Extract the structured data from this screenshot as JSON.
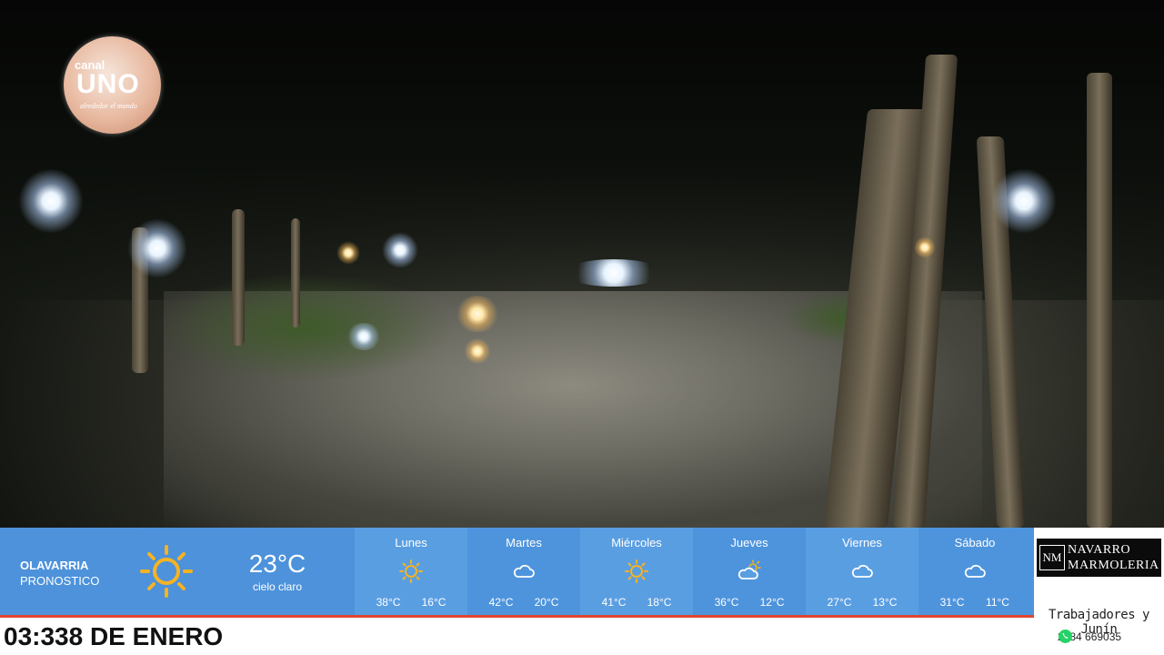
{
  "stream": {
    "channel_logo": {
      "line1": "canal",
      "line2": "UNO",
      "tagline": "alrededor el mundo",
      "icon": "channel-logo"
    }
  },
  "weather": {
    "location": "OLAVARRIA",
    "subtitle": "PRONOSTICO",
    "current": {
      "icon": "sun-icon",
      "temperature": "23°C",
      "condition": "cielo claro"
    },
    "forecast": [
      {
        "day": "Lunes",
        "icon": "sun-icon",
        "high": "38°C",
        "low": "16°C"
      },
      {
        "day": "Martes",
        "icon": "cloud-icon",
        "high": "42°C",
        "low": "20°C"
      },
      {
        "day": "Miércoles",
        "icon": "sun-icon",
        "high": "41°C",
        "low": "18°C"
      },
      {
        "day": "Jueves",
        "icon": "partly-cloudy-icon",
        "high": "36°C",
        "low": "12°C"
      },
      {
        "day": "Viernes",
        "icon": "cloud-icon",
        "high": "27°C",
        "low": "13°C"
      },
      {
        "day": "Sábado",
        "icon": "cloud-icon",
        "high": "31°C",
        "low": "11°C"
      }
    ]
  },
  "ticker": {
    "text": "03:338 DE ENERO"
  },
  "sponsor": {
    "initials": "NM",
    "name_line1": "NAVARRO",
    "name_line2": "MARMOLERIA",
    "address": "Trabajadores y Junín",
    "phone": "2284 669035"
  },
  "colors": {
    "panel_blue": "#4a90d9",
    "accent_red": "#e0452f",
    "sun_yellow": "#f5b324"
  }
}
